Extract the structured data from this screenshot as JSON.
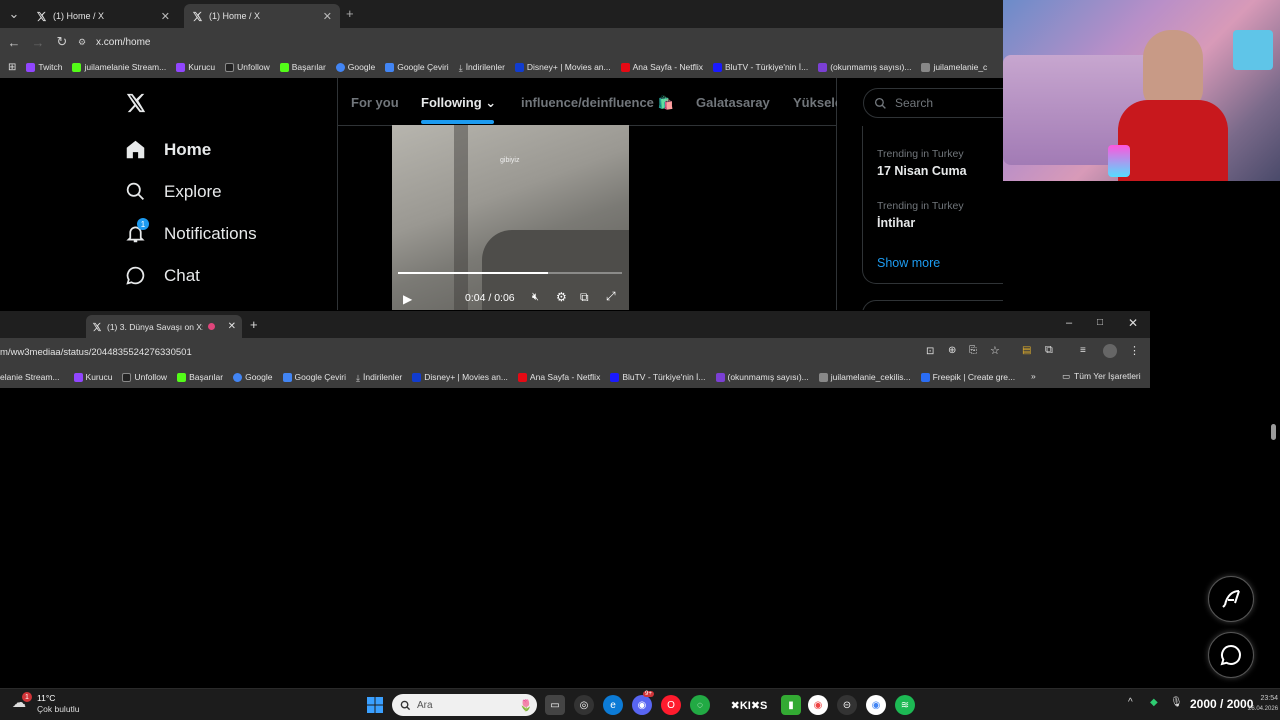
{
  "back_browser": {
    "tabs": [
      {
        "label": "(1) Home / X"
      },
      {
        "label": "(1) Home / X"
      }
    ],
    "url": "x.com/home",
    "bookmarks": [
      "Twitch",
      "juilamelanie Stream...",
      "Kurucu",
      "Unfollow",
      "Başarılar",
      "Google",
      "Google Çeviri",
      "İndirilenler",
      "Disney+ | Movies an...",
      "Ana Sayfa - Netflix",
      "BluTV - Türkiye'nin İ...",
      "(okunmamış sayısı)...",
      "juilamelanie_c"
    ]
  },
  "x_sidebar": {
    "items": [
      {
        "label": "Home",
        "icon": "home-icon"
      },
      {
        "label": "Explore",
        "icon": "search-icon"
      },
      {
        "label": "Notifications",
        "icon": "bell-icon",
        "badge": "1"
      },
      {
        "label": "Chat",
        "icon": "chat-icon"
      }
    ]
  },
  "timeline": {
    "tabs": [
      "For you",
      "Following",
      "influence/deinfluence 🛍️",
      "Galatasaray",
      "Yüksele"
    ],
    "active_tab": "Following",
    "video": {
      "watermark": "gibiyiz",
      "time": "0:04 / 0:06",
      "progress": 0.67
    }
  },
  "right_column": {
    "search_placeholder": "Search",
    "trends": [
      {
        "meta": "Trending in Turkey",
        "name": "17 Nisan Cuma"
      },
      {
        "meta": "Trending in Turkey",
        "name": "İntihar"
      }
    ],
    "show_more": "Show more"
  },
  "front_browser": {
    "tab_label": "(1) 3. Dünya Savaşı on X: \"",
    "url": "m/ww3mediaa/status/2044835524276330501",
    "bookmarks": [
      "elanie Stream...",
      "Kurucu",
      "Unfollow",
      "Başarılar",
      "Google",
      "Google Çeviri",
      "İndirilenler",
      "Disney+ | Movies an...",
      "Ana Sayfa - Netflix",
      "BluTV - Türkiye'nin İ...",
      "(okunmamış sayısı)...",
      "juilamelanie_cekilis...",
      "Freepik | Create gre..."
    ],
    "more_bookmarks": "»",
    "all_bookmarks": "Tüm Yer İşaretleri"
  },
  "taskbar": {
    "weather_temp": "11°C",
    "weather_desc": "Çok bulutlu",
    "weather_badge": "1",
    "search_placeholder": "Ara",
    "counter": "2000 / 2000",
    "clock_time": "23:54",
    "clock_date": "26.04.2026",
    "discord_badge": "9+"
  },
  "colors": {
    "x_blue": "#1d9bf0",
    "chrome_dark": "#1f1f1f",
    "chrome_mid": "#3c3c3c"
  }
}
